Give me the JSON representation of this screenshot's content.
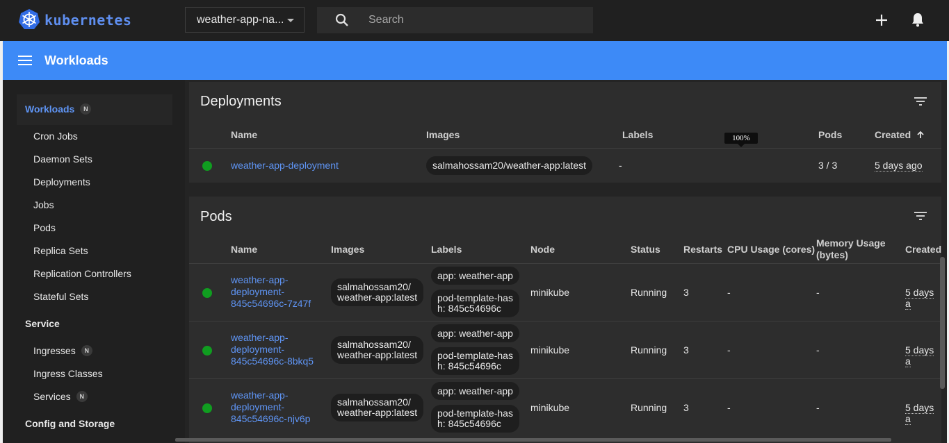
{
  "app": {
    "brand": "kubernetes",
    "namespace": "weather-app-na...",
    "search_placeholder": "Search"
  },
  "header": {
    "title": "Workloads"
  },
  "sidebar": {
    "items": [
      {
        "label": "Workloads",
        "badge": "N",
        "kind": "category",
        "active": true
      },
      {
        "label": "Cron Jobs",
        "kind": "item"
      },
      {
        "label": "Daemon Sets",
        "kind": "item"
      },
      {
        "label": "Deployments",
        "kind": "item"
      },
      {
        "label": "Jobs",
        "kind": "item"
      },
      {
        "label": "Pods",
        "kind": "item"
      },
      {
        "label": "Replica Sets",
        "kind": "item"
      },
      {
        "label": "Replication Controllers",
        "kind": "item"
      },
      {
        "label": "Stateful Sets",
        "kind": "item"
      },
      {
        "label": "Service",
        "kind": "category"
      },
      {
        "label": "Ingresses",
        "badge": "N",
        "kind": "item"
      },
      {
        "label": "Ingress Classes",
        "kind": "item"
      },
      {
        "label": "Services",
        "badge": "N",
        "kind": "item"
      },
      {
        "label": "Config and Storage",
        "kind": "category"
      }
    ]
  },
  "deployments": {
    "title": "Deployments",
    "columns": {
      "name": "Name",
      "images": "Images",
      "labels": "Labels",
      "pods": "Pods",
      "created": "Created"
    },
    "tooltip": "100%",
    "rows": [
      {
        "status": "green",
        "name": "weather-app-deployment",
        "image": "salmahossam20/weather-app:latest",
        "labels": "-",
        "pods": "3 / 3",
        "created": "5 days ago"
      }
    ]
  },
  "pods": {
    "title": "Pods",
    "columns": {
      "name": "Name",
      "images": "Images",
      "labels": "Labels",
      "node": "Node",
      "status": "Status",
      "restarts": "Restarts",
      "cpu": "CPU Usage (cores)",
      "memory_line1": "Memory Usage",
      "memory_line2": "(bytes)",
      "created": "Created"
    },
    "rows": [
      {
        "name_line1": "weather-app-",
        "name_line2": "deployment-",
        "name_line3": "845c54696c-7z47f",
        "image_line1": "salmahossam20/",
        "image_line2": "weather-app:latest",
        "label1": "app: weather-app",
        "label2_line1": "pod-template-has",
        "label2_line2": "h: 845c54696c",
        "node": "minikube",
        "status": "Running",
        "restarts": "3",
        "cpu": "-",
        "memory": "-",
        "created": "5 days a"
      },
      {
        "name_line1": "weather-app-",
        "name_line2": "deployment-",
        "name_line3": "845c54696c-8bkq5",
        "image_line1": "salmahossam20/",
        "image_line2": "weather-app:latest",
        "label1": "app: weather-app",
        "label2_line1": "pod-template-has",
        "label2_line2": "h: 845c54696c",
        "node": "minikube",
        "status": "Running",
        "restarts": "3",
        "cpu": "-",
        "memory": "-",
        "created": "5 days a"
      },
      {
        "name_line1": "weather-app-",
        "name_line2": "deployment-",
        "name_line3": "845c54696c-njv6p",
        "image_line1": "salmahossam20/",
        "image_line2": "weather-app:latest",
        "label1": "app: weather-app",
        "label2_line1": "pod-template-has",
        "label2_line2": "h: 845c54696c",
        "node": "minikube",
        "status": "Running",
        "restarts": "3",
        "cpu": "-",
        "memory": "-",
        "created": "5 days a"
      }
    ]
  },
  "colors": {
    "accent": "#3d8af7",
    "link": "#5f95f5",
    "running": "#109d20",
    "background": "#202020",
    "card": "#2d2d2d"
  }
}
